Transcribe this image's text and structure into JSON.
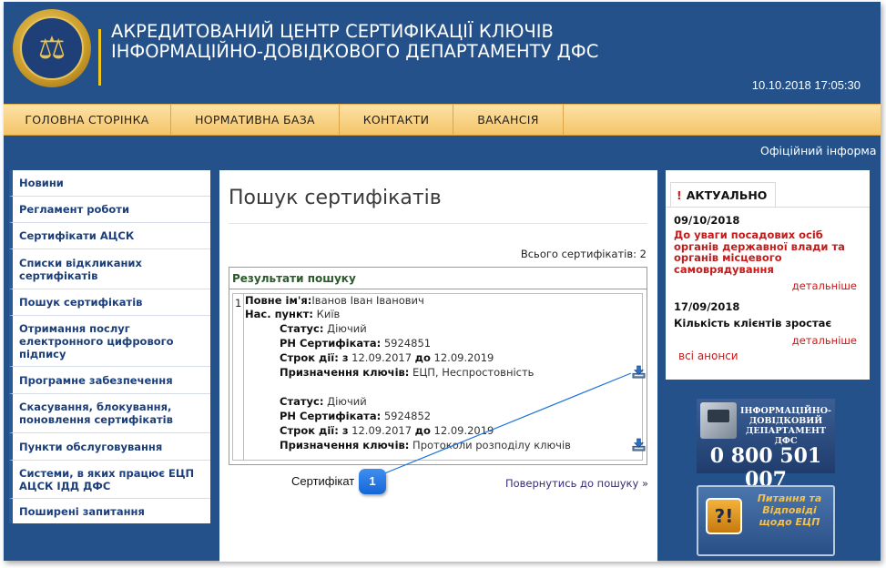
{
  "header": {
    "title_line1": "АКРЕДИТОВАНИЙ ЦЕНТР СЕРТИФІКАЦІЇ КЛЮЧІВ",
    "title_line2": "ІНФОРМАЦІЙНО-ДОВІДКОВОГО ДЕПАРТАМЕНТУ ДФС",
    "datetime": "10.10.2018 17:05:30"
  },
  "nav": [
    "ГОЛОВНА СТОРІНКА",
    "НОРМАТИВНА БАЗА",
    "КОНТАКТИ",
    "ВАКАНСІЯ"
  ],
  "marquee": "Офіційний інформа",
  "sidebar": [
    "Новини",
    "Регламент роботи",
    "Сертифікати АЦСК",
    "Списки відкликаних сертифікатів",
    "Пошук сертифікатів",
    "Отримання послуг електронного цифрового підпису",
    "Програмне забезпечення",
    "Скасування, блокування, поновлення сертифікатів",
    "Пункти обслуговування",
    "Системи, в яких працює ЕЦП АЦСК ІДД ДФС",
    "Поширені запитання"
  ],
  "content": {
    "title": "Пошук сертифікатів",
    "total": "Всього сертифікатів: 2",
    "results_header": "Результати пошуку",
    "row_number": "1",
    "full_name_label": "Повне ім'я:",
    "full_name": "Іванов Іван Іванович",
    "locality_label": "Нас. пункт:",
    "locality": " Київ",
    "certs": [
      {
        "status_label": "Статус:",
        "status": " Діючий",
        "rn_label": "РН Сертифіката:",
        "rn": " 5924851",
        "validity_label": "Строк дії: з",
        "valid_from": " 12.09.2017 ",
        "to_label": "до",
        "valid_to": " 12.09.2019",
        "purpose_label": "Призначення ключів:",
        "purpose": " ЕЦП, Неспростовність"
      },
      {
        "status_label": "Статус:",
        "status": " Діючий",
        "rn_label": "РН Сертифіката:",
        "rn": " 5924852",
        "validity_label": "Строк дії: з",
        "valid_from": " 12.09.2017 ",
        "to_label": "до",
        "valid_to": " 12.09.2019",
        "purpose_label": "Призначення ключів:",
        "purpose": " Протоколи розподілу ключів"
      }
    ],
    "back_link": "Повернутись до пошуку »"
  },
  "callout": {
    "label": "Сертифікат",
    "number": "1",
    "color": "#1f74e0"
  },
  "news": {
    "tab_mark": "!",
    "tab_label": "АКТУАЛЬНО",
    "items": [
      {
        "date": "09/10/2018",
        "title": "До уваги посадових осіб органів державної влади та органів місцевого самоврядування",
        "more": "детальніше",
        "title_color": "#c41b1b"
      },
      {
        "date": "17/09/2018",
        "title": "Кількість клієнтів зростає",
        "more": "детальніше",
        "title_color": "#111111"
      }
    ],
    "all": "всі анонси"
  },
  "banners": {
    "phone_text": "ІНФОРМАЦІЙНО-ДОВІДКОВИЙ ДЕПАРТАМЕНТ ДФС",
    "phone_number": "0 800 501 007",
    "qa_mark": "?!",
    "qa_text": "Питання та Відповіді щодо ЕЦП"
  }
}
